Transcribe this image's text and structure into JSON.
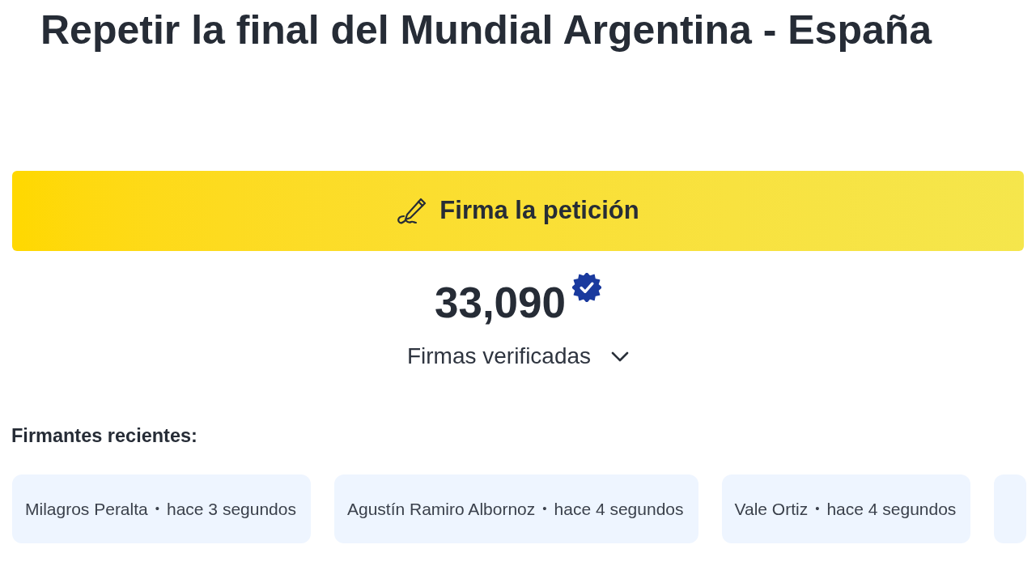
{
  "title": "Repetir la final del Mundial Argentina - España",
  "sign_button": {
    "label": "Firma la petición"
  },
  "signature_count": {
    "value": "33,090",
    "verified": true,
    "label": "Firmas verificadas",
    "expanded": false
  },
  "recent_signers": {
    "heading": "Firmantes recientes:",
    "items": [
      {
        "name": "Milagros Peralta",
        "separator": "•",
        "time": "hace 3 segundos"
      },
      {
        "name": "Agustín Ramiro Albornoz",
        "separator": "•",
        "time": "hace 4 segundos"
      },
      {
        "name": "Vale Ortiz",
        "separator": "•",
        "time": "hace 4 segundos"
      }
    ]
  }
}
